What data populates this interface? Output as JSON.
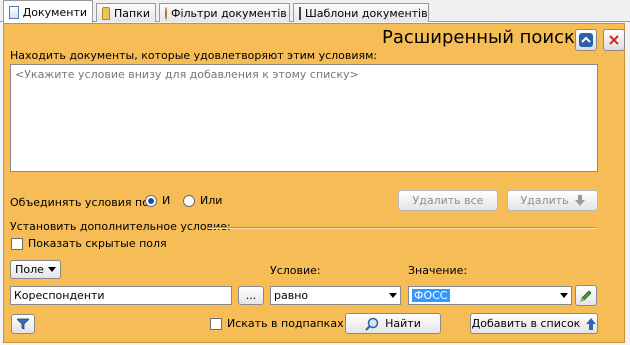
{
  "tabs": [
    {
      "label": "Документи",
      "icon": "document-icon"
    },
    {
      "label": "Папки",
      "icon": "folder-icon"
    },
    {
      "label": "Фільтри документів",
      "icon": "filter-icon"
    },
    {
      "label": "Шаблони документів",
      "icon": "template-icon"
    }
  ],
  "header": {
    "title": "Расширенный поиск"
  },
  "conditions": {
    "label": "Находить документы, которые удовлетворяют этим условиям:",
    "placeholder": "<Укажите условие внизу для добавления к этому списку>"
  },
  "combine": {
    "label": "Объединять условия по:",
    "and_label": "И",
    "or_label": "Или",
    "selected": "И"
  },
  "buttons": {
    "delete_all": "Удалить все",
    "delete": "Удалить",
    "find": "Найти",
    "add_to_list": "Добавить в список",
    "browse": "..."
  },
  "additional": {
    "label": "Установить дополнительное условие:",
    "show_hidden": "Показать скрытые поля",
    "field_button": "Поле",
    "condition_label": "Условие:",
    "value_label": "Значение:",
    "field_value": "Кореспонденти",
    "condition_value": "равно",
    "value_value": "ФОСС",
    "search_subfolders": "Искать в подпапках"
  },
  "colors": {
    "panel": "#f6bc55",
    "selection": "#3399ff"
  }
}
